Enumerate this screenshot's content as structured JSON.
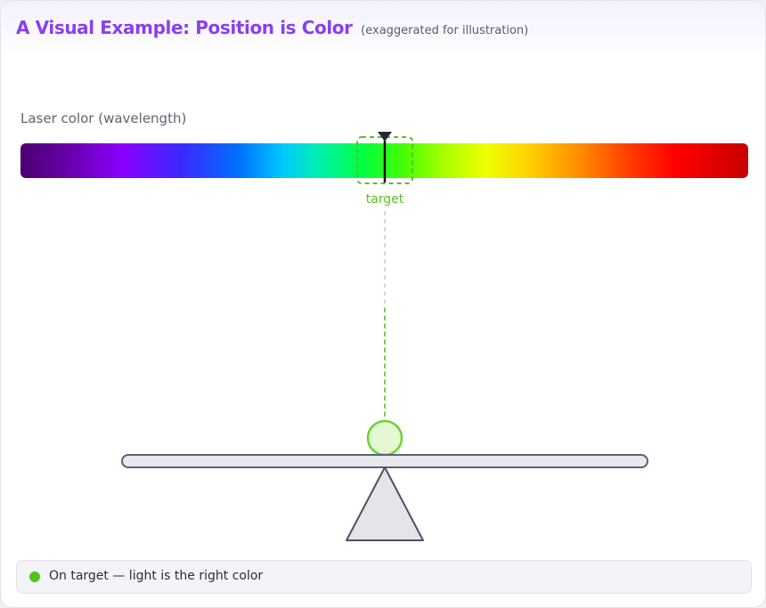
{
  "header": {
    "title": "A Visual Example: Position is Color",
    "subtitle": "(exaggerated for illustration)"
  },
  "spectrum": {
    "label": "Laser color (wavelength)",
    "target_label": "target"
  },
  "status": {
    "text": "On target — light is the right color",
    "color": "#52c41a"
  },
  "colors": {
    "title": "#8a3ff0",
    "target": "#5cc026",
    "marker": "#23283a",
    "beam": "#a8b4c8",
    "ball_fill": "#e4f8d4",
    "ball_stroke": "#6bd334",
    "lever_fill": "#e8e9ee",
    "lever_stroke": "#5b6072"
  }
}
